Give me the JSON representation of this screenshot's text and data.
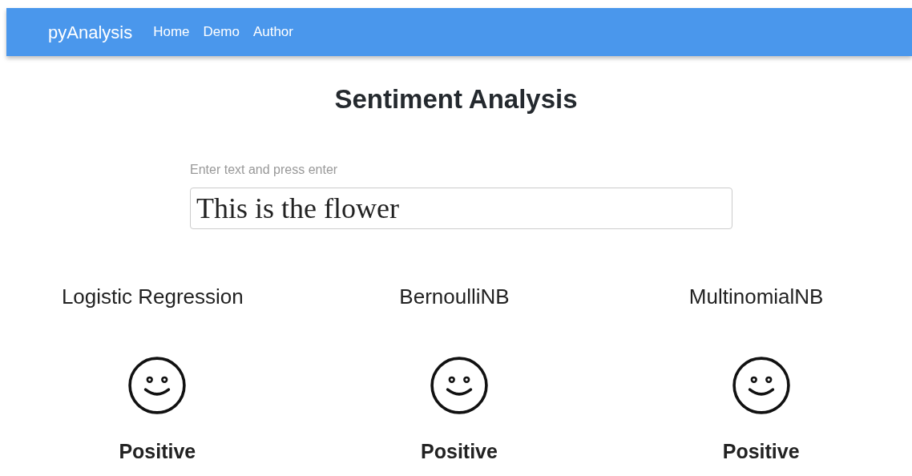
{
  "navbar": {
    "brand": "pyAnalysis",
    "links": [
      "Home",
      "Demo",
      "Author"
    ]
  },
  "title": "Sentiment Analysis",
  "input": {
    "label": "Enter text and press enter",
    "value": "This is the flower"
  },
  "models": [
    {
      "name": "Logistic Regression",
      "sentiment": "Positive",
      "kind": "positive"
    },
    {
      "name": "BernoulliNB",
      "sentiment": "Positive",
      "kind": "positive"
    },
    {
      "name": "MultinomialNB",
      "sentiment": "Positive",
      "kind": "positive"
    }
  ]
}
